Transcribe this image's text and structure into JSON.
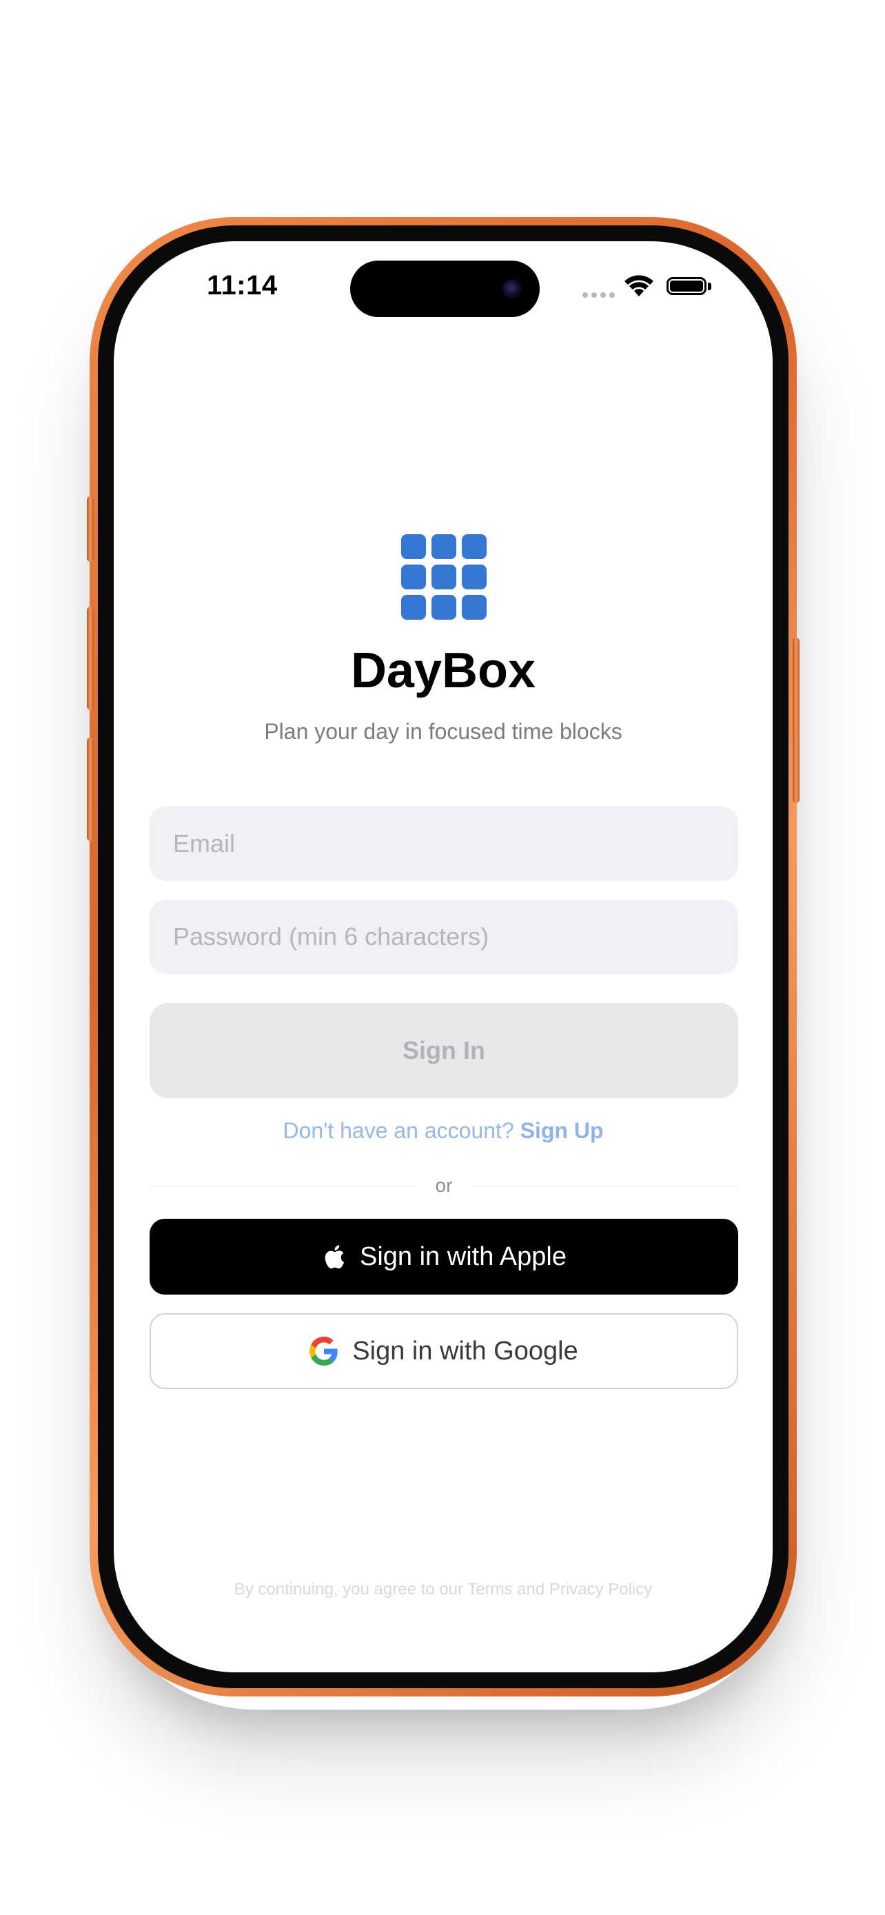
{
  "status_bar": {
    "time": "11:14",
    "wifi_icon": "wifi-icon",
    "battery_icon": "battery-full-icon"
  },
  "app": {
    "name": "DayBox",
    "tagline": "Plan your day in focused time blocks",
    "logo_icon": "grid-3x3-icon",
    "accent_color": "#3478d4"
  },
  "form": {
    "email_placeholder": "Email",
    "password_placeholder": "Password (min 6 characters)",
    "email_value": "",
    "password_value": "",
    "sign_in_label": "Sign In"
  },
  "signup": {
    "prompt": "Don't have an account? ",
    "link_label": "Sign Up"
  },
  "divider": {
    "label": "or"
  },
  "social": {
    "apple_label": "Sign in with Apple",
    "apple_icon": "apple-logo-icon",
    "google_label": "Sign in with Google",
    "google_icon": "google-logo-icon"
  },
  "footer": {
    "text": "By continuing, you agree to our Terms and Privacy Policy"
  },
  "device": {
    "frame_color": "#e0743a"
  }
}
